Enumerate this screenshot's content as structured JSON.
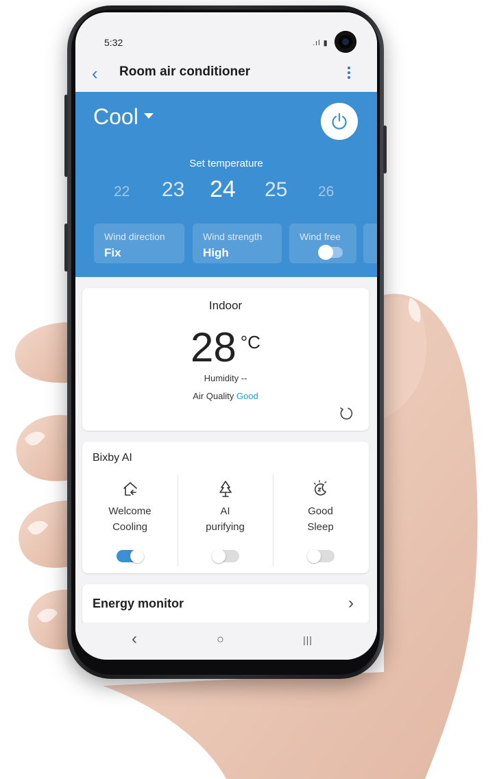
{
  "status_bar": {
    "time": "5:32"
  },
  "app_bar": {
    "title": "Room air conditioner"
  },
  "mode": {
    "label": "Cool"
  },
  "temperature": {
    "label": "Set temperature",
    "values": [
      "22",
      "23",
      "24",
      "25",
      "26"
    ],
    "selected_unit": "°"
  },
  "controls": [
    {
      "label": "Wind direction",
      "value": "Fix"
    },
    {
      "label": "Wind strength",
      "value": "High"
    },
    {
      "label": "Wind free",
      "state": "off"
    }
  ],
  "indoor": {
    "title": "Indoor",
    "temperature": "28",
    "unit": "°C",
    "humidity": "Humidity --",
    "air_quality_label": "Air Quality",
    "air_quality_value": "Good"
  },
  "bixby": {
    "title": "Bixby AI",
    "features": [
      {
        "line1": "Welcome",
        "line2": "Cooling",
        "icon": "home-arrow-icon",
        "on": true
      },
      {
        "line1": "AI",
        "line2": "purifying",
        "icon": "tree-icon",
        "on": false
      },
      {
        "line1": "Good",
        "line2": "Sleep",
        "icon": "moon-sleep-icon",
        "on": false
      }
    ]
  },
  "energy": {
    "label": "Energy monitor"
  },
  "nav": {
    "back": "‹",
    "home": "○",
    "recent": "|||"
  },
  "colors": {
    "accent": "#3d8fd3",
    "good": "#2a9ad6"
  }
}
